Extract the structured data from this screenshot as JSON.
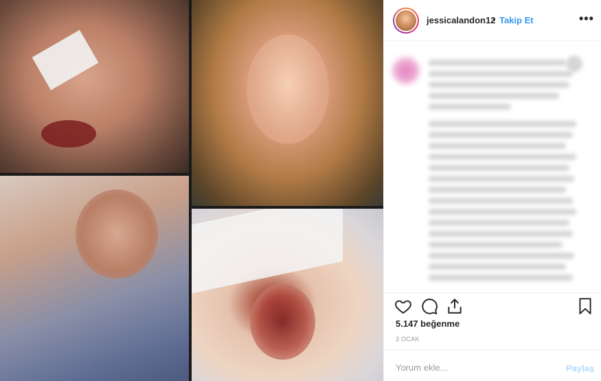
{
  "post": {
    "username": "jessicalandon12",
    "separator": "•",
    "follow_label": "Takip Et",
    "more_label": "•••",
    "likes": "5.147 beğenme",
    "date": "3 OCAK",
    "comment_placeholder": "Yorum ekle...",
    "share_label": "Paylaş"
  },
  "colors": {
    "accent": "#3897f0",
    "disabled_accent": "#b3dbff",
    "text": "#262626",
    "muted": "#999999"
  },
  "icons": [
    "heart-icon",
    "comment-icon",
    "share-icon",
    "bookmark-icon",
    "more-options-icon"
  ]
}
